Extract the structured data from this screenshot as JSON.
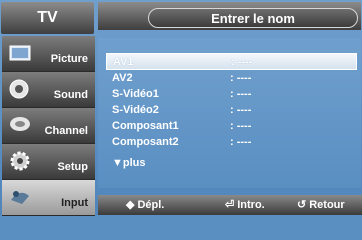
{
  "header": {
    "app_title": "TV",
    "panel_title": "Entrer le nom"
  },
  "sidebar": {
    "items": [
      {
        "label": "Picture",
        "icon": "picture-icon"
      },
      {
        "label": "Sound",
        "icon": "sound-icon"
      },
      {
        "label": "Channel",
        "icon": "channel-icon"
      },
      {
        "label": "Setup",
        "icon": "setup-icon"
      },
      {
        "label": "Input",
        "icon": "input-icon",
        "active": true
      }
    ]
  },
  "list": {
    "rows": [
      {
        "name": "AV1",
        "value": ": ----",
        "selected": true
      },
      {
        "name": "AV2",
        "value": ": ----"
      },
      {
        "name": "S-Vidéo1",
        "value": ": ----"
      },
      {
        "name": "S-Vidéo2",
        "value": ": ----"
      },
      {
        "name": "Composant1",
        "value": ": ----"
      },
      {
        "name": "Composant2",
        "value": ": ----"
      }
    ],
    "more_label": "▼plus"
  },
  "footer": {
    "move_icon": "◆",
    "move_label": "Dépl.",
    "enter_icon": "⏎",
    "enter_label": "Intro.",
    "return_icon": "↺",
    "return_label": "Retour"
  },
  "colors": {
    "background": "#5a8fc2",
    "bar_dark": "#3e3e3e",
    "active_tab": "#d9d9d9"
  }
}
